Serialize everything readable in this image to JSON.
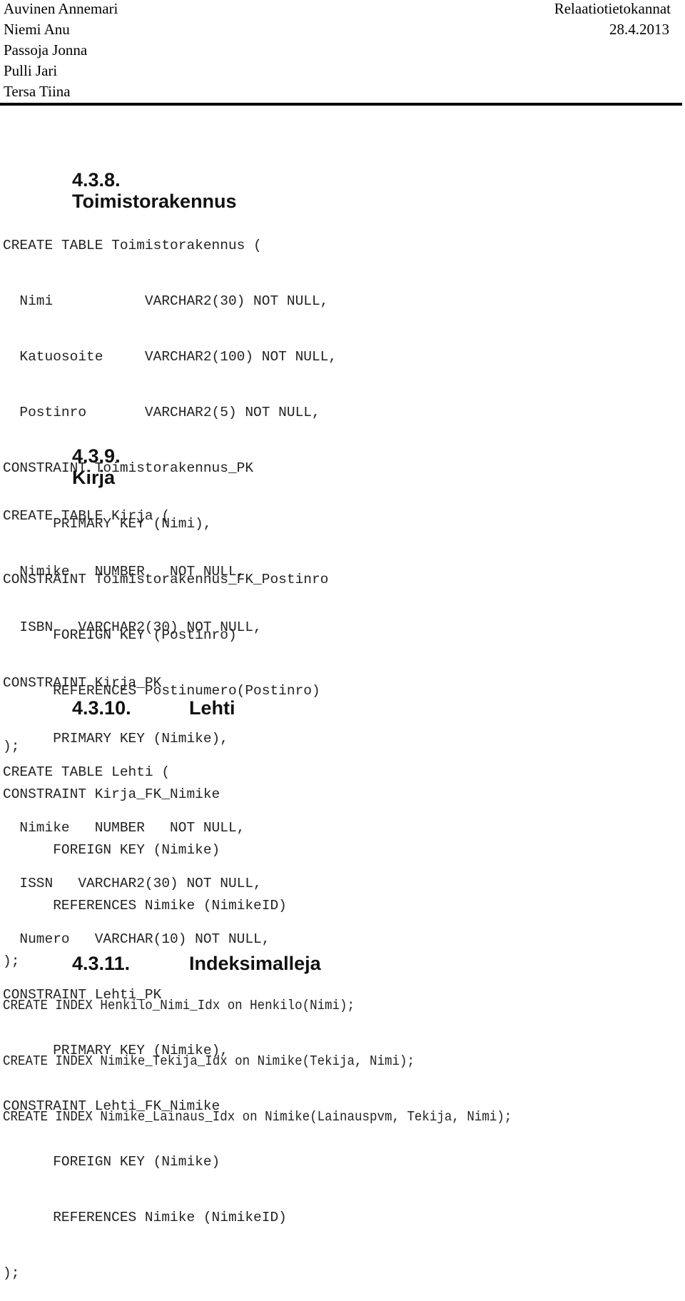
{
  "header": {
    "authors": [
      "Auvinen Annemari",
      "Niemi Anu",
      "Passoja Jonna",
      "Pulli Jari",
      "Tersa Tiina"
    ],
    "course": "Relaatiotietokannat",
    "date": "28.4.2013"
  },
  "sections": [
    {
      "number": "4.3.8.",
      "title": "Toimistorakennus",
      "code": [
        "CREATE TABLE Toimistorakennus (",
        "  Nimi           VARCHAR2(30) NOT NULL,",
        "  Katuosoite     VARCHAR2(100) NOT NULL,",
        "  Postinro       VARCHAR2(5) NOT NULL,",
        "CONSTRAINT Toimistorakennus_PK",
        "      PRIMARY KEY (Nimi),",
        "CONSTRAINT Toimistorakennus_FK_Postinro",
        "      FOREIGN KEY (Postinro)",
        "      REFERENCES Postinumero(Postinro)",
        ");"
      ]
    },
    {
      "number": "4.3.9.",
      "title": "Kirja",
      "code": [
        "CREATE TABLE Kirja (",
        "  Nimike   NUMBER   NOT NULL,",
        "  ISBN   VARCHAR2(30) NOT NULL,",
        "CONSTRAINT Kirja_PK",
        "      PRIMARY KEY (Nimike),",
        "CONSTRAINT Kirja_FK_Nimike",
        "      FOREIGN KEY (Nimike)",
        "      REFERENCES Nimike (NimikeID)",
        ");"
      ]
    },
    {
      "number": "4.3.10.",
      "title": "Lehti",
      "code": [
        "CREATE TABLE Lehti (",
        "  Nimike   NUMBER   NOT NULL,",
        "  ISSN   VARCHAR2(30) NOT NULL,",
        "  Numero   VARCHAR(10) NOT NULL,",
        "CONSTRAINT Lehti_PK",
        "      PRIMARY KEY (Nimike),",
        "CONSTRAINT Lehti_FK_Nimike",
        "      FOREIGN KEY (Nimike)",
        "      REFERENCES Nimike (NimikeID)",
        ");"
      ]
    },
    {
      "number": "4.3.11.",
      "title": "Indeksimalleja",
      "code": [
        "CREATE INDEX Henkilo_Nimi_Idx on Henkilo(Nimi);",
        "CREATE INDEX Nimike_Tekija_Idx on Nimike(Tekija, Nimi);",
        "CREATE INDEX Nimike_Lainaus_Idx on Nimike(Lainauspvm, Tekija, Nimi);"
      ]
    }
  ]
}
